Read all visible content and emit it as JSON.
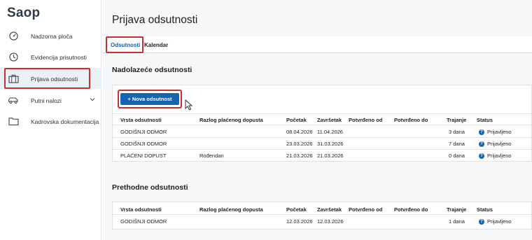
{
  "app": {
    "logo": "Saop"
  },
  "sidebar": {
    "items": [
      {
        "label": "Nadzorna ploča",
        "icon": "dashboard-icon"
      },
      {
        "label": "Evidencija prisutnosti",
        "icon": "clock-icon"
      },
      {
        "label": "Prijava odsutnosti",
        "icon": "briefcase-icon"
      },
      {
        "label": "Putni nalozi",
        "icon": "car-icon"
      },
      {
        "label": "Kadrovska dokumentacija",
        "icon": "folder-icon"
      }
    ]
  },
  "main": {
    "title": "Prijava odsutnosti",
    "tabs": [
      {
        "label": "Odsutnosti"
      },
      {
        "label": "Kalendar"
      }
    ],
    "upcoming": {
      "title": "Nadolazeće odsutnosti",
      "button": "+ Nova odsutnost",
      "headers": [
        "Vrsta odsutnosti",
        "Razlog plaćenog dopusta",
        "Početak",
        "Završetak",
        "Potvrđeno od",
        "Potvrđeno do",
        "Trajanje",
        "Status"
      ],
      "rows": [
        [
          "GODIŠNJI ODMOR",
          "",
          "08.04.2026",
          "11.04.2026",
          "",
          "",
          "3 dana",
          "Prijavljeno"
        ],
        [
          "GODIŠNJI ODMOR",
          "",
          "23.03.2026",
          "31.03.2026",
          "",
          "",
          "7 dana",
          "Prijavljeno"
        ],
        [
          "PLAĆENI DOPUST",
          "Rođendan",
          "21.03.2026",
          "21.03.2026",
          "",
          "",
          "0 dana",
          "Prijavljeno"
        ]
      ]
    },
    "previous": {
      "title": "Prethodne odsutnosti",
      "headers": [
        "Vrsta odsutnosti",
        "Razlog plaćenog dopusta",
        "Početak",
        "Završetak",
        "Potvrđeno od",
        "Potvrđeno do",
        "Trajanje",
        "Status"
      ],
      "rows": [
        [
          "GODIŠNJI ODMOR",
          "",
          "12.03.2026",
          "12.03.2026",
          "",
          "",
          "1 dana",
          "Prijavljeno"
        ]
      ]
    }
  },
  "colors": {
    "accent": "#1565b3",
    "highlight": "#c8302b"
  }
}
